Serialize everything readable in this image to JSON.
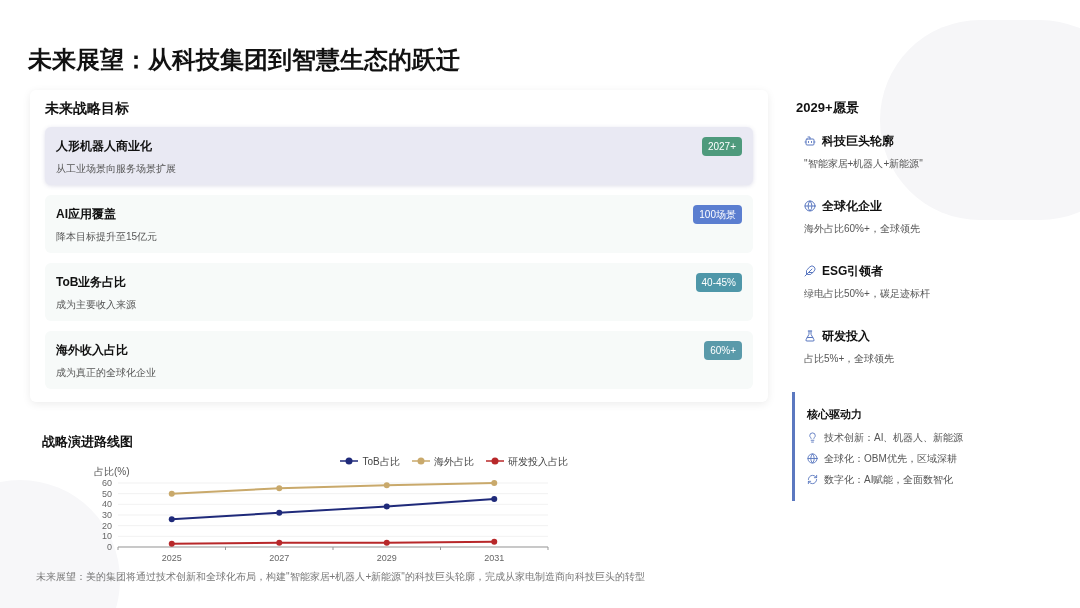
{
  "title": "未来展望：从科技集团到智慧生态的跃迁",
  "goals": {
    "heading": "未来战略目标",
    "items": [
      {
        "name": "人形机器人商业化",
        "desc": "从工业场景向服务场景扩展",
        "badge": "2027+",
        "color": "#4e9a7c",
        "selected": true
      },
      {
        "name": "AI应用覆盖",
        "desc": "降本目标提升至15亿元",
        "badge": "100场景",
        "color": "#5b7ed0",
        "selected": false
      },
      {
        "name": "ToB业务占比",
        "desc": "成为主要收入来源",
        "badge": "40-45%",
        "color": "#4f97a9",
        "selected": false
      },
      {
        "name": "海外收入占比",
        "desc": "成为真正的全球化企业",
        "badge": "60%+",
        "color": "#5a9aaa",
        "selected": false
      }
    ]
  },
  "roadmap": {
    "heading": "战略演进路线图",
    "chart_data": {
      "type": "line",
      "ylabel": "占比(%)",
      "categories": [
        "2025",
        "2027",
        "2029",
        "2031"
      ],
      "ylim": [
        0,
        60
      ],
      "yticks": [
        0,
        10,
        20,
        30,
        40,
        50,
        60
      ],
      "grid": true,
      "legend": true,
      "series": [
        {
          "name": "ToB占比",
          "color": "#1f2a7a",
          "values": [
            26,
            32,
            38,
            45
          ],
          "marker": "circle"
        },
        {
          "name": "海外占比",
          "color": "#c9a96b",
          "values": [
            50,
            55,
            58,
            60
          ],
          "marker": "circle"
        },
        {
          "name": "研发投入占比",
          "color": "#b8282a",
          "values": [
            3,
            4,
            4,
            5
          ],
          "marker": "circle"
        }
      ]
    }
  },
  "footnote": "未来展望：美的集团将通过技术创新和全球化布局，构建\"智能家居+机器人+新能源\"的科技巨头轮廓，完成从家电制造商向科技巨头的转型",
  "vision": {
    "heading": "2029+愿景",
    "items": [
      {
        "name": "科技巨头轮廓",
        "desc": "\"智能家居+机器人+新能源\""
      },
      {
        "name": "全球化企业",
        "desc": "海外占比60%+，全球领先"
      },
      {
        "name": "ESG引领者",
        "desc": "绿电占比50%+，碳足迹标杆"
      },
      {
        "name": "研发投入",
        "desc": "占比5%+，全球领先"
      }
    ]
  },
  "drivers": {
    "heading": "核心驱动力",
    "items": [
      "技术创新：AI、机器人、新能源",
      "全球化：OBM优先，区域深耕",
      "数字化：AI赋能，全面数智化"
    ]
  }
}
